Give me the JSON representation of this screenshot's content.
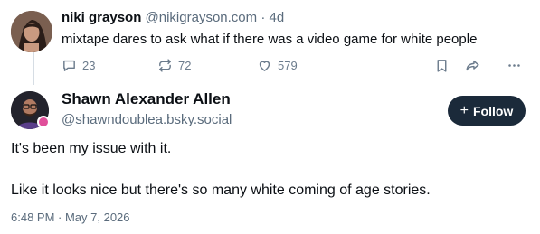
{
  "parent_post": {
    "author_name": "niki grayson",
    "author_handle": "@nikigrayson.com",
    "separator": "·",
    "time": "4d",
    "text": "mixtape dares to ask what if there was a video game for white people",
    "reply_count": "23",
    "repost_count": "72",
    "like_count": "579",
    "icons": [
      "reply-icon",
      "repost-icon",
      "like-icon",
      "bookmark-icon",
      "share-icon",
      "more-icon"
    ]
  },
  "reply_post": {
    "author_name": "Shawn Alexander Allen",
    "author_handle": "@shawndoublea.bsky.social",
    "follow_label": "Follow",
    "follow_icon": "+",
    "text_line1": "It's been my issue with it.",
    "text_line2": "Like it looks nice but there's so many white coming of age stories.",
    "timestamp": "6:48 PM · May 7, 2026"
  },
  "colors": {
    "follow_button": "#1b2a3a",
    "muted_text": "#5a6b7c",
    "icon_gray": "#6b7b8c",
    "thread_line": "#d6dde4",
    "avatar_badge": "#e04f9a"
  }
}
